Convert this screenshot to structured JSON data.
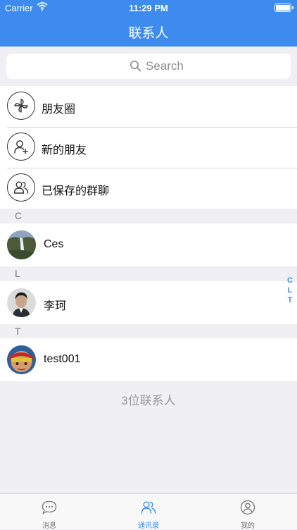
{
  "status_bar": {
    "carrier": "Carrier",
    "time": "11:29 PM"
  },
  "nav": {
    "title": "联系人"
  },
  "search": {
    "placeholder": "Search"
  },
  "menu": [
    {
      "label": "朋友圈",
      "icon": "pinwheel-icon"
    },
    {
      "label": "新的朋友",
      "icon": "add-friend-icon"
    },
    {
      "label": "已保存的群聊",
      "icon": "group-icon"
    }
  ],
  "sections": [
    {
      "letter": "C",
      "contacts": [
        {
          "name": "Ces"
        }
      ]
    },
    {
      "letter": "L",
      "contacts": [
        {
          "name": "李珂"
        }
      ]
    },
    {
      "letter": "T",
      "contacts": [
        {
          "name": "test001"
        }
      ]
    }
  ],
  "footer": {
    "count_text": "3位联系人"
  },
  "index_bar": [
    "C",
    "L",
    "T"
  ],
  "tabs": [
    {
      "label": "消息",
      "icon": "chat-bubble-icon",
      "active": false
    },
    {
      "label": "通讯录",
      "icon": "contacts-icon",
      "active": true
    },
    {
      "label": "我的",
      "icon": "profile-icon",
      "active": false
    }
  ],
  "colors": {
    "accent": "#3d8bef",
    "background": "#efeff4"
  }
}
